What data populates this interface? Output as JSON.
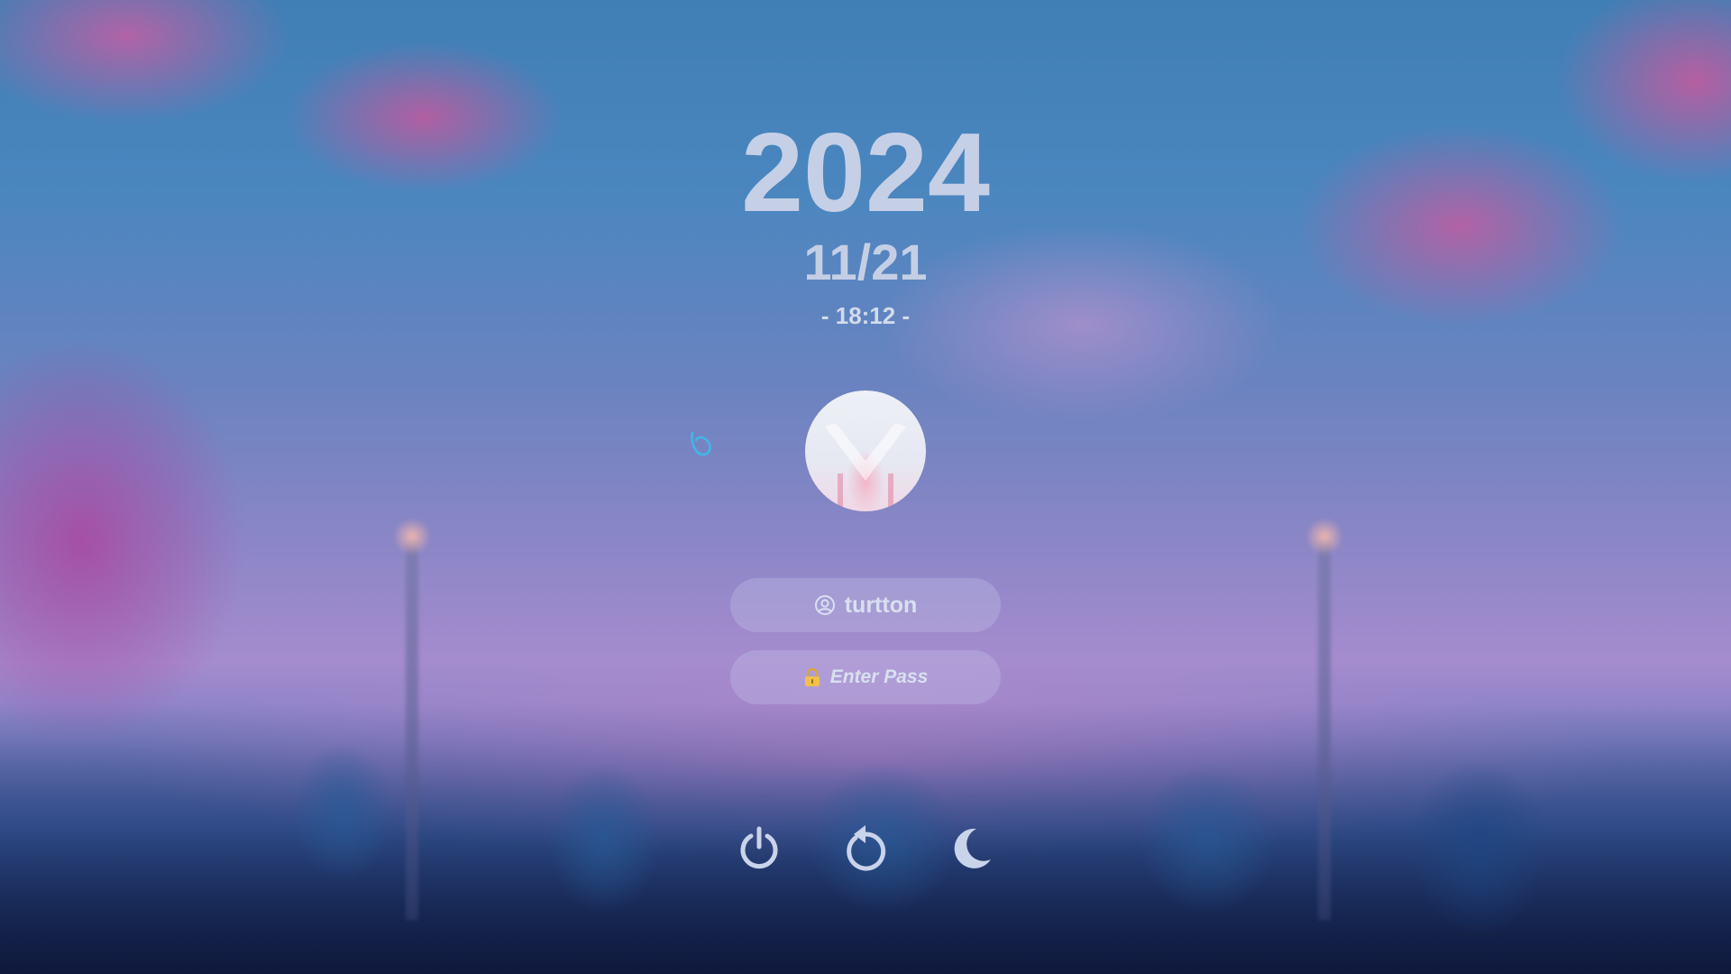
{
  "clock": {
    "year": "2024",
    "date": "11/21",
    "time": "- 18:12 -"
  },
  "login": {
    "avatar": "user-avatar",
    "username": "turtton",
    "user_icon": "user-circle-icon",
    "password_placeholder": "Enter Pass",
    "lock_icon": "lock-icon",
    "lock_glyph": "🔒"
  },
  "actions": [
    {
      "name": "shutdown",
      "icon": "power-icon"
    },
    {
      "name": "reboot",
      "icon": "reboot-icon"
    },
    {
      "name": "suspend",
      "icon": "moon-icon"
    }
  ],
  "colors": {
    "text": "#c5d0e6",
    "field_bg": "rgba(205,205,240,0.28)",
    "cursor": "#3fb8e8"
  }
}
